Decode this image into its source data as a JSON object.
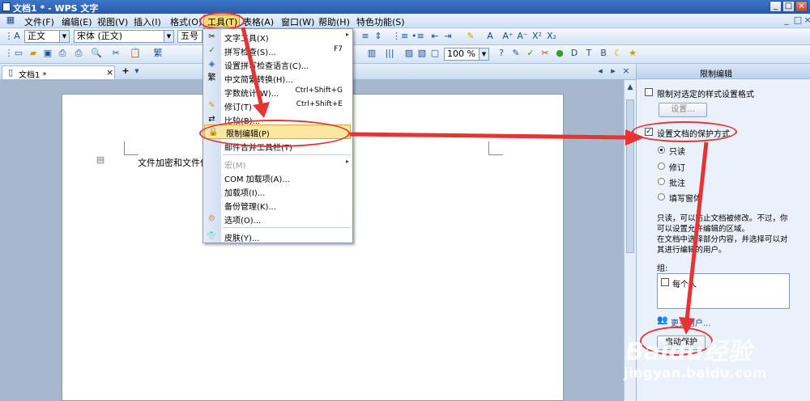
{
  "window": {
    "title": "文档1 * - WPS 文字",
    "min": "_",
    "max": "□",
    "close": "×"
  },
  "menubar": {
    "items": [
      "文件(F)",
      "编辑(E)",
      "视图(V)",
      "插入(I)",
      "格式(O)",
      "工具(T)",
      "表格(A)",
      "窗口(W)",
      "帮助(H)",
      "特色功能(S)"
    ]
  },
  "toolbar1": {
    "style": "正文",
    "font": "宋体 (正文)",
    "size": "五号"
  },
  "toolbar2": {
    "zoom": "100 %"
  },
  "tabs": {
    "doc": "文档1 *"
  },
  "document": {
    "text": "文件加密和文件保"
  },
  "tools_menu": {
    "items": [
      {
        "label": "文字工具(X)",
        "shortcut": "",
        "submenu": "▸"
      },
      {
        "label": "拼写检查(S)...",
        "shortcut": "F7"
      },
      {
        "label": "设置拼写检查语言(C)..."
      },
      {
        "label": "中文简繁转换(H)..."
      },
      {
        "label": "字数统计(W)...",
        "shortcut": "Ctrl+Shift+G"
      },
      {
        "label": "修订(T)",
        "shortcut": "Ctrl+Shift+E"
      },
      {
        "label": "比较(B)..."
      },
      {
        "label": "限制编辑(P)"
      },
      {
        "label": "邮件合并工具栏(T)"
      },
      {
        "label": "宏(M)",
        "submenu": "▸"
      },
      {
        "label": "COM 加载项(A)..."
      },
      {
        "label": "加载项(I)..."
      },
      {
        "label": "备份管理(K)..."
      },
      {
        "label": "选项(O)..."
      },
      {
        "label": "皮肤(Y)..."
      }
    ]
  },
  "pane": {
    "title": "限制编辑",
    "restrict_format": "限制对选定的样式设置格式",
    "settings_button": "设置...",
    "protect_method": "设置文档的保护方式",
    "options": [
      "只读",
      "修订",
      "批注",
      "填写窗体"
    ],
    "description": [
      "只读，可以防止文档被修改。不过，你",
      "可以设置允许编辑的区域。",
      "在文档中选择部分内容，并选择可以对",
      "其进行编辑的用户。"
    ],
    "group_label": "组:",
    "everyone": "每个人",
    "more_users": "更多用户...",
    "start_button": "启动保护"
  },
  "watermark": {
    "brand": "Baidu经验",
    "url": "jingyan.baidu.com"
  },
  "colors": {
    "accent_red": "#e63333",
    "highlight": "#fbe6a2"
  }
}
